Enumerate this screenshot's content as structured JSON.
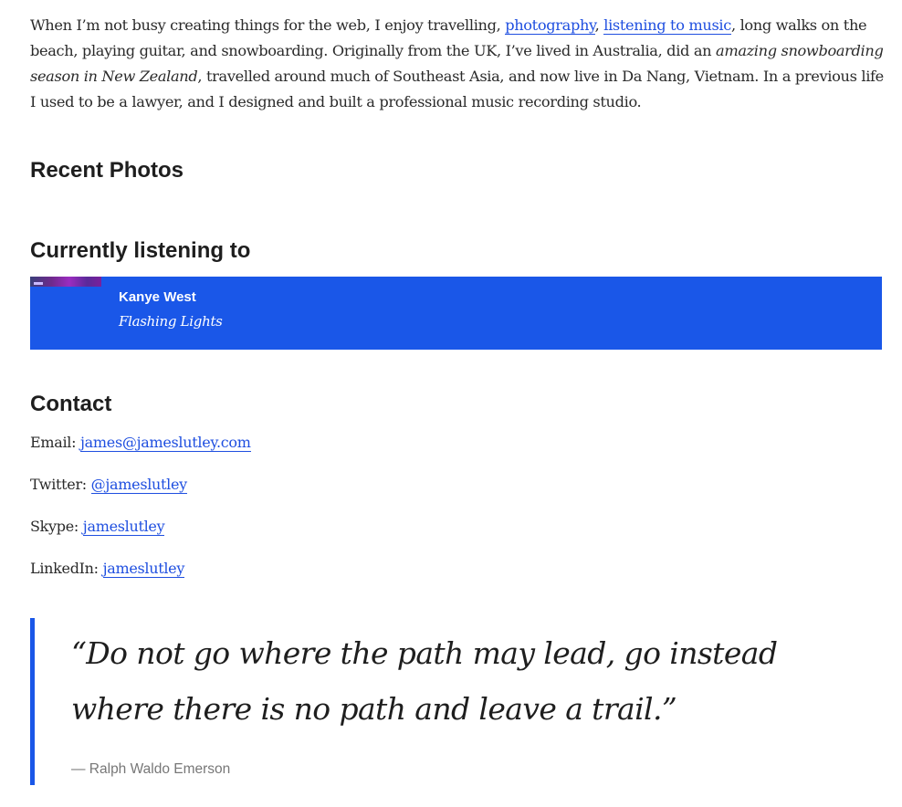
{
  "bio": {
    "p1": "When I’m not busy creating things for the web, I enjoy travelling, ",
    "link_photography": "photography",
    "sep1": ", ",
    "link_music": "listening to music",
    "p2": ", long walks on the beach, playing guitar, and snowboarding. Originally from the UK, I’ve lived in Australia, did an ",
    "em_snow": "amazing snowboarding season in New Zealand",
    "p3": ", travelled around much of Southeast Asia, and now live in Da Nang, Vietnam. In a previous life I used to be a lawyer, and I designed and built a professional music recording studio."
  },
  "sections": {
    "recent_photos": "Recent Photos",
    "currently_listening": "Currently listening to",
    "contact": "Contact"
  },
  "now_playing": {
    "artist": "Kanye West",
    "track": "Flashing Lights"
  },
  "contact": {
    "email_label": "Email: ",
    "email_value": "james@jameslutley.com",
    "twitter_label": "Twitter: ",
    "twitter_value": "@jameslutley",
    "skype_label": "Skype: ",
    "skype_value": "jameslutley",
    "linkedin_label": "LinkedIn: ",
    "linkedin_value": "jameslutley"
  },
  "quote": {
    "text": "“Do not go where the path may lead, go instead where there is no path and leave a trail.”",
    "cite": "— Ralph Waldo Emerson"
  },
  "colors": {
    "accent": "#1a57e8",
    "link": "#1f4fe0",
    "text": "#222222",
    "muted": "#777777"
  }
}
